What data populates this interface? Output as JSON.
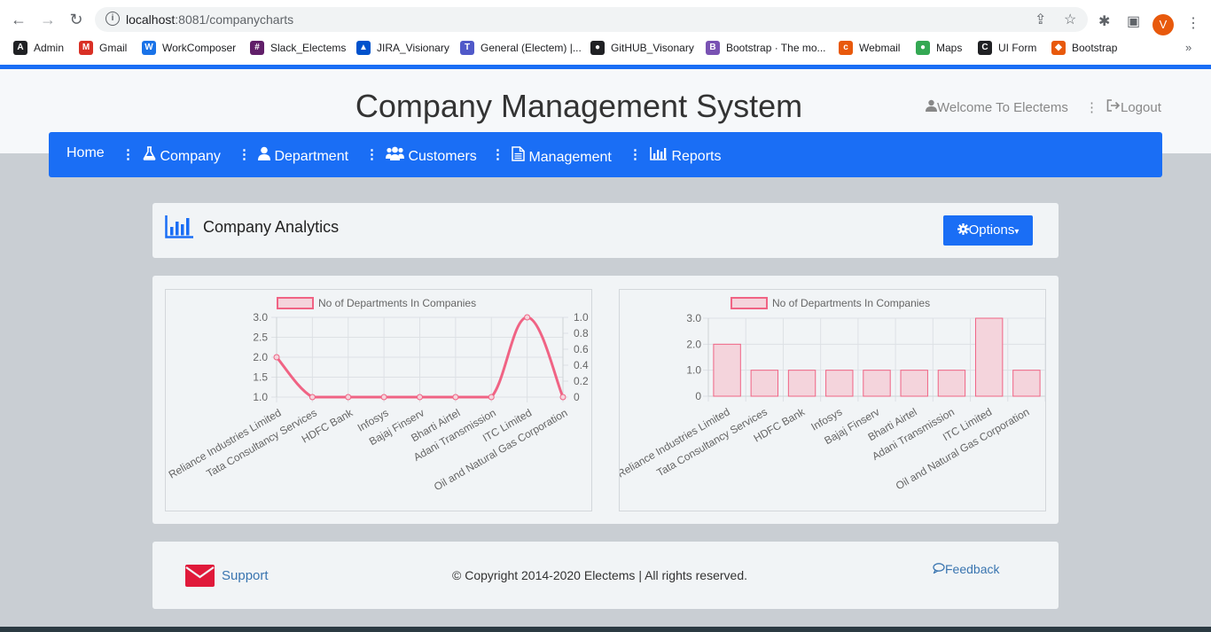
{
  "browser": {
    "url_host": "localhost",
    "url_rest": ":8081/companycharts",
    "profile_initial": "V",
    "bookmarks": [
      {
        "label": "Admin",
        "icon": "angular-icon",
        "color": "#202124"
      },
      {
        "label": "Gmail",
        "icon": "gmail-icon",
        "color": "#d93025"
      },
      {
        "label": "WorkComposer",
        "icon": "workcomposer-icon",
        "color": "#1a73e8"
      },
      {
        "label": "Slack_Electems",
        "icon": "slack-icon",
        "color": "#611f69"
      },
      {
        "label": "JIRA_Visionary",
        "icon": "jira-icon",
        "color": "#0052cc"
      },
      {
        "label": "General (Electem) |...",
        "icon": "teams-icon",
        "color": "#5059c9"
      },
      {
        "label": "GitHUB_Visonary",
        "icon": "github-icon",
        "color": "#202124"
      },
      {
        "label": "Bootstrap · The mo...",
        "icon": "bootstrap-icon",
        "color": "#7952b3"
      },
      {
        "label": "Webmail",
        "icon": "webmail-icon",
        "color": "#e8590c"
      },
      {
        "label": "Maps",
        "icon": "maps-icon",
        "color": "#34a853"
      },
      {
        "label": "UI Form",
        "icon": "codepen-icon",
        "color": "#202124"
      },
      {
        "label": "Bootstrap",
        "icon": "shield-icon",
        "color": "#e8590c"
      }
    ]
  },
  "header": {
    "title": "Company Management System",
    "welcome": "Welcome To Electems",
    "separator": "⋮",
    "logout": "Logout"
  },
  "nav": {
    "items": [
      {
        "label": "Home",
        "icon": ""
      },
      {
        "label": "Company",
        "icon": "flask-icon"
      },
      {
        "label": "Department",
        "icon": "user-icon"
      },
      {
        "label": "Customers",
        "icon": "users-icon"
      },
      {
        "label": "Management",
        "icon": "file-icon"
      },
      {
        "label": "Reports",
        "icon": "bar-chart-icon"
      }
    ],
    "separator": "⋮"
  },
  "analytics": {
    "title": "Company Analytics",
    "options_label": "Options",
    "options_caret": "▾"
  },
  "footer": {
    "support": "Support",
    "copyright": "© Copyright 2014-2020 Electems | All rights reserved.",
    "feedback": "Feedback"
  },
  "chart_data": [
    {
      "type": "line",
      "legend": "No of Departments In Companies",
      "categories": [
        "Reliance Industries Limited",
        "Tata Consultancy Services",
        "HDFC Bank",
        "Infosys",
        "Bajaj Finserv",
        "Bharti Airtel",
        "Adani Transmission",
        "ITC Limited",
        "Oil and Natural Gas Corporation"
      ],
      "values": [
        2,
        1,
        1,
        1,
        1,
        1,
        1,
        3,
        1
      ],
      "y_ticks": [
        "3.0",
        "2.5",
        "2.0",
        "1.5",
        "1.0"
      ],
      "y2_ticks": [
        "1.0",
        "0.8",
        "0.6",
        "0.4",
        "0.2",
        "0"
      ],
      "ylim": [
        1,
        3
      ],
      "y2lim": [
        0,
        1
      ],
      "color": "#f06384",
      "grid": true
    },
    {
      "type": "bar",
      "legend": "No of Departments In Companies",
      "categories": [
        "Reliance Industries Limited",
        "Tata Consultancy Services",
        "HDFC Bank",
        "Infosys",
        "Bajaj Finserv",
        "Bharti Airtel",
        "Adani Transmission",
        "ITC Limited",
        "Oil and Natural Gas Corporation"
      ],
      "values": [
        2,
        1,
        1,
        1,
        1,
        1,
        1,
        3,
        1
      ],
      "y_ticks": [
        "3.0",
        "2.0",
        "1.0",
        "0"
      ],
      "ylim": [
        0,
        3
      ],
      "color": "#f06384",
      "fill": "#f4d4dc",
      "grid": true
    }
  ]
}
